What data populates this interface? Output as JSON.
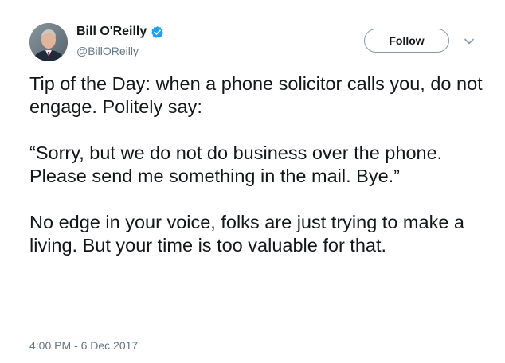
{
  "author": {
    "name": "Bill O'Reilly",
    "handle": "@BillOReilly",
    "verified": true,
    "verified_color": "#1da1f2"
  },
  "actions": {
    "follow_label": "Follow",
    "more_icon": "chevron-down-icon"
  },
  "tweet": {
    "paragraphs": [
      "Tip of the Day: when a phone solicitor calls you, do not engage. Politely say:",
      "“Sorry, but we do not do business over the phone. Please send me something in the mail. Bye.”",
      "No edge in your voice, folks are just trying to make a living. But your time is too valuable for that."
    ],
    "timestamp": "4:00 PM - 6 Dec 2017"
  }
}
